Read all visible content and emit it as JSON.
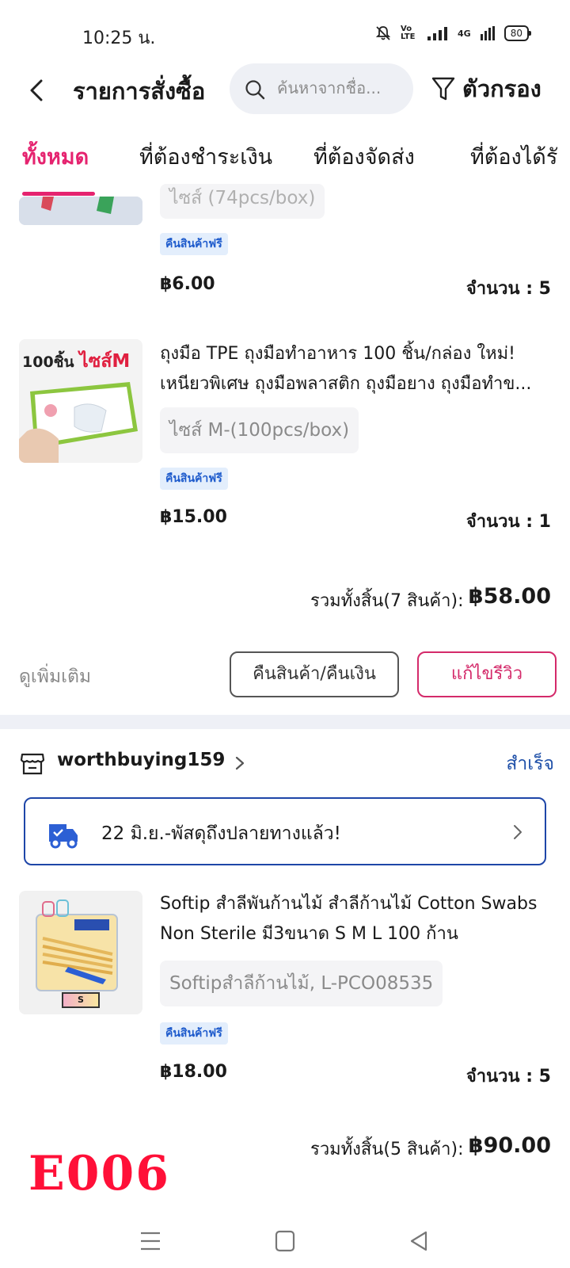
{
  "status_bar": {
    "time": "10:25 น.",
    "network": "4G",
    "volte": "Vo LTE",
    "battery": "80"
  },
  "header": {
    "title": "รายการสั่งซื้อ",
    "search_placeholder": "ค้นหาจากชื่อ...",
    "filter_label": "ตัวกรอง"
  },
  "tabs": [
    {
      "label": "ทั้งหมด",
      "active": true
    },
    {
      "label": "ที่ต้องชำระเงิน",
      "active": false
    },
    {
      "label": "ที่ต้องจัดส่ง",
      "active": false
    },
    {
      "label": "ที่ต้องได้รั",
      "active": false
    }
  ],
  "order1": {
    "partial_item": {
      "variant": "ไซส์ (74pcs/box)",
      "badge": "คืนสินค้าฟรี",
      "price": "฿6.00",
      "qty": "จำนวน : 5"
    },
    "item": {
      "thumb_text_count": "100ชิ้น",
      "thumb_text_size": "ไซส์M",
      "title": "ถุงมือ TPE ถุงมือทำอาหาร 100 ชิ้น/กล่อง ใหม่! เหนียวพิเศษ ถุงมือพลาสติก ถุงมือยาง ถุงมือทำข...",
      "variant": "ไซส์ M-(100pcs/box)",
      "badge": "คืนสินค้าฟรี",
      "price": "฿15.00",
      "qty": "จำนวน : 1"
    },
    "total_label": "รวมทั้งสิ้น(7 สินค้า):",
    "total_value": "฿58.00",
    "more_link": "ดูเพิ่มเติม",
    "return_button": "คืนสินค้า/คืนเงิน",
    "review_button": "แก้ไขรีวิว"
  },
  "order2": {
    "shop_name": "worthbuying159",
    "status": "สำเร็จ",
    "delivery_text": "22 มิ.ย.-พัสดุถึงปลายทางแล้ว!",
    "item": {
      "thumb_label": "S",
      "title": "Softip สำลีพันก้านไม้ สำลีก้านไม้ Cotton Swabs Non Sterile มี3ขนาด S M L 100 ก้าน",
      "variant": "Softipสำลีก้านไม้, L-PCO08535",
      "badge": "คืนสินค้าฟรี",
      "price": "฿18.00",
      "qty": "จำนวน : 5"
    },
    "total_label": "รวมทั้งสิ้น(5 สินค้า):",
    "total_value": "฿90.00"
  },
  "overlay_stamp": "E006",
  "colors": {
    "accent_pink": "#e5236f",
    "link_blue": "#1e4fa8",
    "badge_bg": "#e3eefc",
    "stamp_red": "#ff1038"
  },
  "icons": [
    "back-arrow-icon",
    "search-icon",
    "filter-icon",
    "shop-icon",
    "chevron-right-icon",
    "truck-icon",
    "menu-icon",
    "home-square-icon",
    "back-triangle-icon"
  ]
}
